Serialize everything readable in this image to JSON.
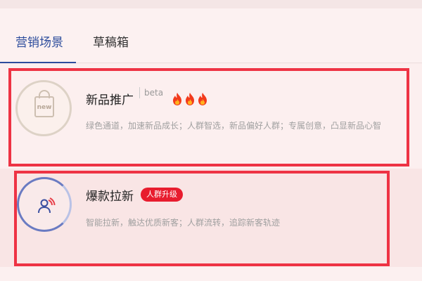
{
  "tabs": [
    {
      "label": "营销场景",
      "active": true
    },
    {
      "label": "草稿箱",
      "active": false
    }
  ],
  "cards": [
    {
      "title": "新品推广",
      "tag": "beta",
      "icon_text": "new",
      "icon": "shopping-bag-icon",
      "hot_level": 3,
      "description": "绿色通道，加速新品成长；人群智选，新品偏好人群；专属创意，凸显新品心智"
    },
    {
      "title": "爆款拉新",
      "badge": "人群升级",
      "icon": "people-icon",
      "description": "智能拉新，触达优质新客；人群流转，追踪新客轨迹"
    }
  ],
  "colors": {
    "accent": "#2c4c9c",
    "highlight": "#ee3344",
    "badge": "#e81c2e"
  }
}
